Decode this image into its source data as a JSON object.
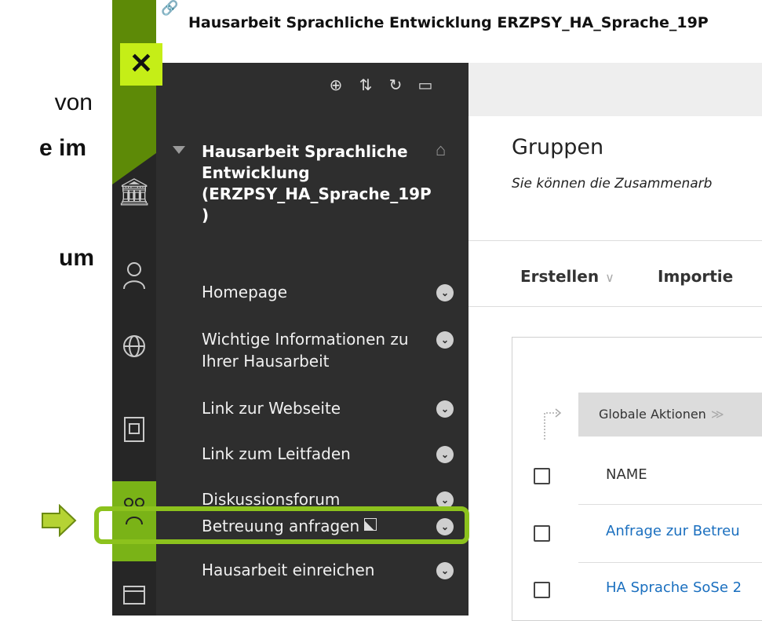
{
  "slide": {
    "line1": "von",
    "line2": "e im",
    "line3": "um"
  },
  "header": {
    "course_title": "Hausarbeit Sprachliche Entwicklung ERZPSY_HA_Sprache_19P"
  },
  "menu": {
    "close": "✕",
    "course_name": "Hausarbeit Sprachliche Entwicklung (ERZPSY_HA_Sprache_19P )",
    "items": [
      {
        "label": "Homepage"
      },
      {
        "label": "Wichtige Informationen zu Ihrer Hausarbeit"
      },
      {
        "label": "Link zur Webseite"
      },
      {
        "label": "Link zum Leitfaden"
      },
      {
        "label": "Diskussionsforum"
      },
      {
        "label": "Betreuung anfragen"
      },
      {
        "label": "Hausarbeit einreichen"
      }
    ]
  },
  "main": {
    "title": "Gruppen",
    "subtitle": "Sie können die Zusammenarb",
    "actions": {
      "create": "Erstellen",
      "import": "Importie"
    },
    "global_actions": "Globale Aktionen",
    "columns": {
      "name": "NAME"
    },
    "rows": [
      {
        "name": "Anfrage zur Betreu"
      },
      {
        "name": "HA Sprache SoSe 2"
      }
    ]
  },
  "colors": {
    "accent": "#7ab317",
    "highlight": "#8cc21d",
    "close_button": "#c5ee17",
    "menu_bg": "#2e2e2e",
    "link": "#1a6fbf"
  }
}
